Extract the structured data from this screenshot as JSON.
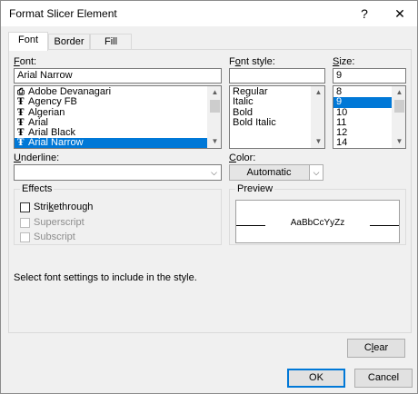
{
  "window": {
    "title": "Format Slicer Element",
    "help_glyph": "?",
    "close_glyph": "✕"
  },
  "tabs": [
    {
      "label": "Font",
      "active": true
    },
    {
      "label": "Border",
      "active": false
    },
    {
      "label": "Fill",
      "active": false
    }
  ],
  "font": {
    "label_prefix": "F",
    "label_rest": "ont:",
    "value": "Arial Narrow",
    "list": [
      {
        "name": "Adobe Devanagari",
        "icon": "printer-font-icon",
        "selected": false
      },
      {
        "name": "Agency FB",
        "icon": "truetype-icon",
        "selected": false
      },
      {
        "name": "Algerian",
        "icon": "truetype-icon",
        "selected": false
      },
      {
        "name": "Arial",
        "icon": "truetype-icon",
        "selected": false
      },
      {
        "name": "Arial Black",
        "icon": "truetype-icon",
        "selected": false
      },
      {
        "name": "Arial Narrow",
        "icon": "truetype-icon",
        "selected": true
      }
    ]
  },
  "font_style": {
    "label_prefix": "F",
    "label_u": "o",
    "label_rest": "nt style:",
    "value": "",
    "list": [
      {
        "name": "Regular",
        "selected": false
      },
      {
        "name": "Italic",
        "selected": false
      },
      {
        "name": "Bold",
        "selected": false
      },
      {
        "name": "Bold Italic",
        "selected": false
      }
    ]
  },
  "size": {
    "label_u": "S",
    "label_rest": "ize:",
    "value": "9",
    "list": [
      {
        "name": "8",
        "selected": false
      },
      {
        "name": "9",
        "selected": true
      },
      {
        "name": "10",
        "selected": false
      },
      {
        "name": "11",
        "selected": false
      },
      {
        "name": "12",
        "selected": false
      },
      {
        "name": "14",
        "selected": false
      }
    ]
  },
  "underline": {
    "label_u": "U",
    "label_rest": "nderline:",
    "value": ""
  },
  "color": {
    "label_u": "C",
    "label_rest": "olor:",
    "value": "Automatic"
  },
  "effects": {
    "title": "Effects",
    "items": [
      {
        "label": "Strikethrough",
        "u": "k",
        "enabled": true,
        "checked": false
      },
      {
        "label": "Superscript",
        "u": "",
        "enabled": false,
        "checked": false
      },
      {
        "label": "Subscript",
        "u": "",
        "enabled": false,
        "checked": false
      }
    ]
  },
  "preview": {
    "title": "Preview",
    "sample": "AaBbCcYyZz"
  },
  "hint": "Select font settings to include in the style.",
  "buttons": {
    "clear": "Clear",
    "ok": "OK",
    "cancel": "Cancel"
  },
  "glyphs": {
    "up": "▲",
    "down": "▼",
    "dropdown": "⌵"
  },
  "colors": {
    "selection": "#0078d7",
    "panel_bg": "#f0f0f0"
  }
}
